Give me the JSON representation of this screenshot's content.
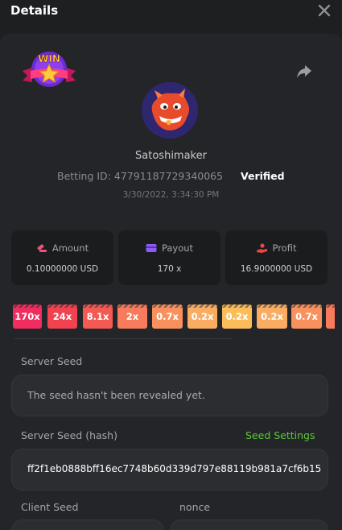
{
  "header": {
    "title": "Details",
    "close_icon": "close-icon"
  },
  "win_badge": {
    "text": "WIN",
    "icon": "win-star-badge"
  },
  "share_icon": "share-arrow-icon",
  "player": {
    "avatar_icon": "red-dragon-avatar",
    "username": "Satoshimaker",
    "betting_id_label": "Betting ID:",
    "betting_id": "47791187729340065",
    "status": "Verified",
    "datetime": "3/30/2022, 3:34:30 PM"
  },
  "stats": [
    {
      "label": "Amount",
      "value": "0.10000000 USD",
      "icon": "coins-icon",
      "color": "#f0517a"
    },
    {
      "label": "Payout",
      "value": "170 x",
      "icon": "wallet-icon",
      "color": "#8b5cf6"
    },
    {
      "label": "Profit",
      "value": "16.9000000 USD",
      "icon": "hand-coin-icon",
      "color": "#ef4444"
    }
  ],
  "multipliers": [
    {
      "text": "170x",
      "color": "#ef2d5e"
    },
    {
      "text": "24x",
      "color": "#f0424f"
    },
    {
      "text": "8.1x",
      "color": "#f45a54"
    },
    {
      "text": "2x",
      "color": "#f77b5c"
    },
    {
      "text": "0.7x",
      "color": "#f8915e"
    },
    {
      "text": "0.2x",
      "color": "#f9ac62"
    },
    {
      "text": "0.2x",
      "color": "#fbbd59"
    },
    {
      "text": "0.2x",
      "color": "#f9ac62"
    },
    {
      "text": "0.7x",
      "color": "#f8915e"
    },
    {
      "text": "",
      "color": "#f77b5c"
    }
  ],
  "server_seed": {
    "label": "Server Seed",
    "value": "The seed hasn't been revealed yet."
  },
  "server_seed_hash": {
    "label": "Server Seed (hash)",
    "settings_link": "Seed Settings",
    "value": "ff2f1eb0888bff16ec7748b60d339d797e88119b981a7cf6b15"
  },
  "client_seed": {
    "label": "Client Seed"
  },
  "nonce": {
    "label": "nonce"
  },
  "colors": {
    "accent_green": "#5bc83a",
    "background": "#1e1f21",
    "panel": "#242528"
  }
}
